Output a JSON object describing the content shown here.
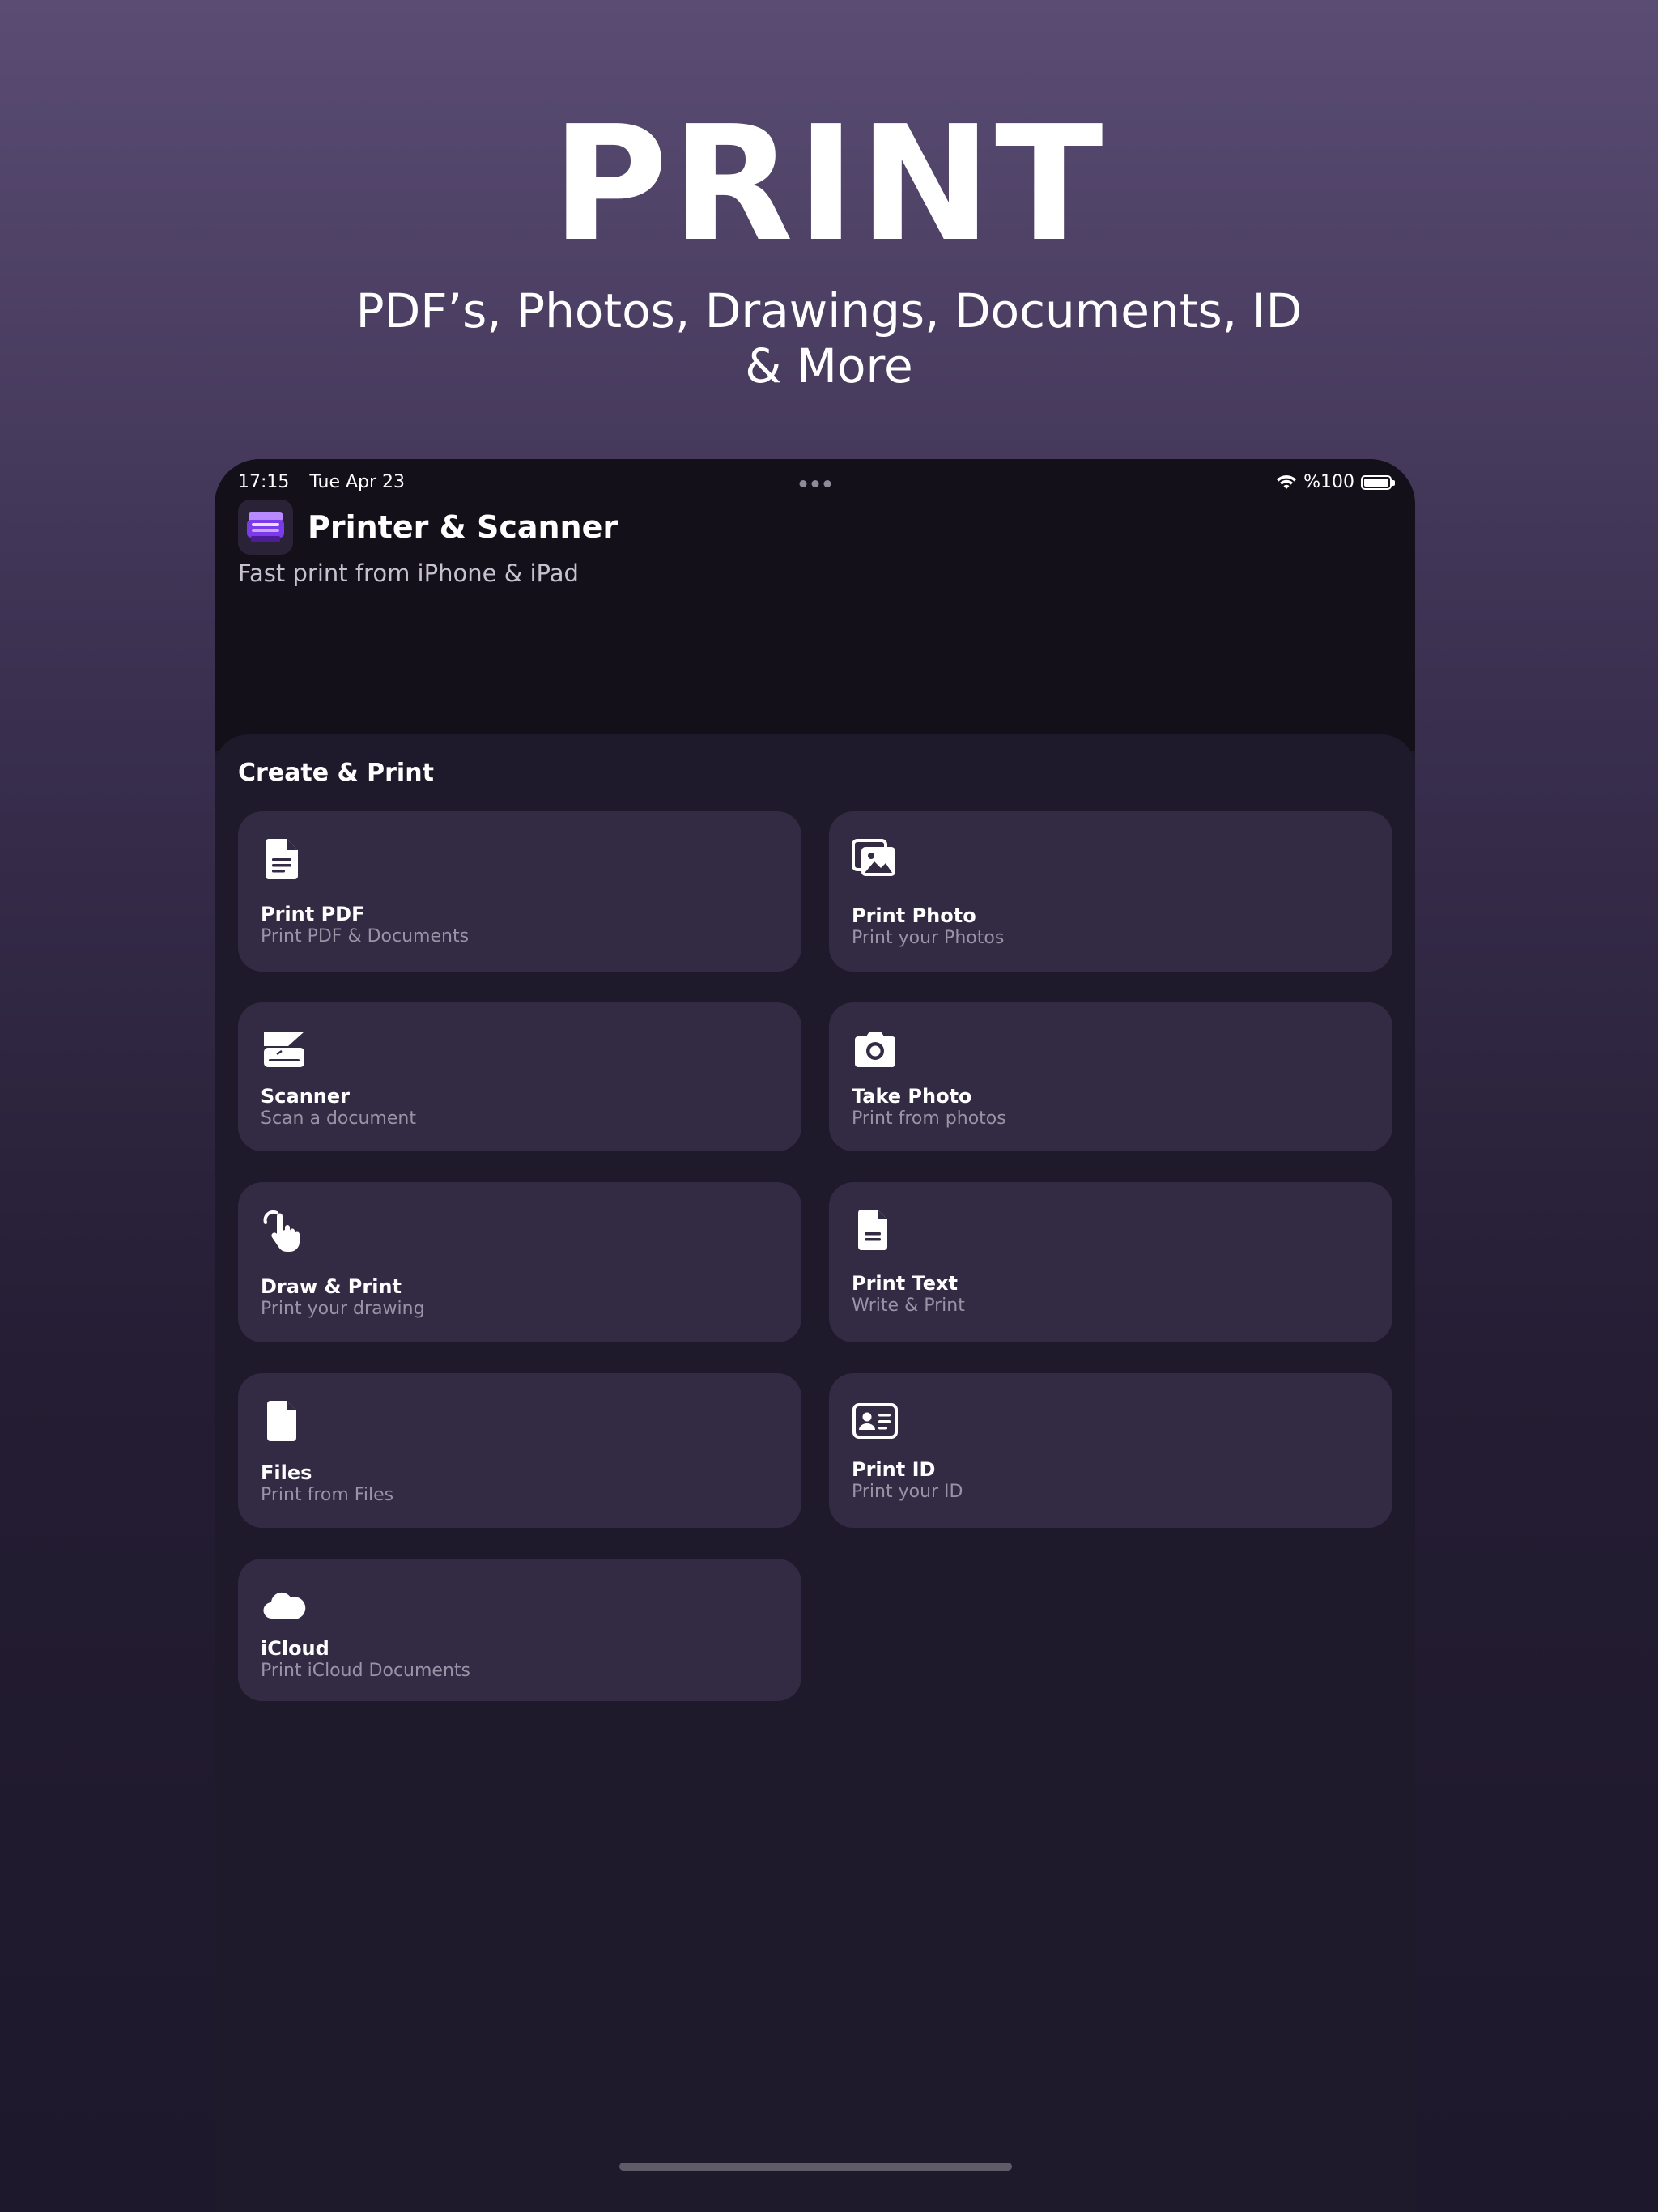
{
  "hero": {
    "title": "PRINT",
    "subtitle": "PDF’s, Photos, Drawings, Documents, ID & More"
  },
  "status_bar": {
    "time": "17:15",
    "date": "Tue Apr 23",
    "battery_text": "%100"
  },
  "app": {
    "title": "Printer & Scanner",
    "subtitle": "Fast print from iPhone & iPad"
  },
  "section": {
    "title": "Create & Print"
  },
  "cards": [
    {
      "label": "Print PDF",
      "desc": "Print PDF & Documents",
      "icon": "pdf-document-icon"
    },
    {
      "label": "Print Photo",
      "desc": "Print your Photos",
      "icon": "photos-icon"
    },
    {
      "label": "Scanner",
      "desc": "Scan a document",
      "icon": "scanner-icon"
    },
    {
      "label": "Take Photo",
      "desc": "Print from photos",
      "icon": "camera-icon"
    },
    {
      "label": "Draw & Print",
      "desc": "Print your drawing",
      "icon": "hand-pointer-icon"
    },
    {
      "label": "Print Text",
      "desc": "Write & Print",
      "icon": "text-document-icon"
    },
    {
      "label": "Files",
      "desc": "Print from Files",
      "icon": "file-icon"
    },
    {
      "label": "Print ID",
      "desc": "Print your ID",
      "icon": "id-card-icon"
    },
    {
      "label": "iCloud",
      "desc": "Print iCloud Documents",
      "icon": "cloud-icon"
    }
  ],
  "colors": {
    "card_bg": "#332b43",
    "sheet_bg": "#1e1a2b",
    "header_bg": "#141019",
    "accent": "#8a5cf6"
  }
}
